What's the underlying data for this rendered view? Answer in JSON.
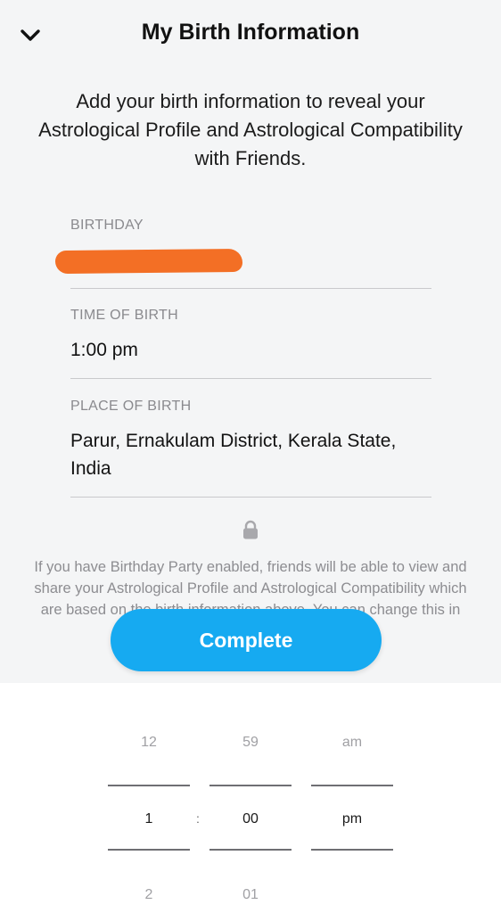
{
  "header": {
    "back_icon": "chevron-down-icon",
    "title": "My Birth Information"
  },
  "intro": "Add your birth information to reveal your Astrological Profile and Astrological Compatibility with Friends.",
  "fields": {
    "birthday": {
      "label": "BIRTHDAY",
      "value": ""
    },
    "time": {
      "label": "TIME OF BIRTH",
      "value": "1:00 pm"
    },
    "place": {
      "label": "PLACE OF BIRTH",
      "value": "Parur, Ernakulam District, Kerala State, India"
    }
  },
  "disclaimer": "If you have Birthday Party enabled, friends will be able to view and share your Astrological Profile and Astrological Compatibility which are based on the birth information above. You can change this in your settings.",
  "complete_label": "Complete",
  "picker": {
    "hour": {
      "prev": "12",
      "selected": "1",
      "next": "2"
    },
    "separator": ":",
    "minute": {
      "prev": "59",
      "selected": "00",
      "next": "01"
    },
    "ampm": {
      "prev": "am",
      "selected": "pm"
    }
  },
  "colors": {
    "accent": "#16aaf1",
    "redaction": "#f36f25"
  }
}
